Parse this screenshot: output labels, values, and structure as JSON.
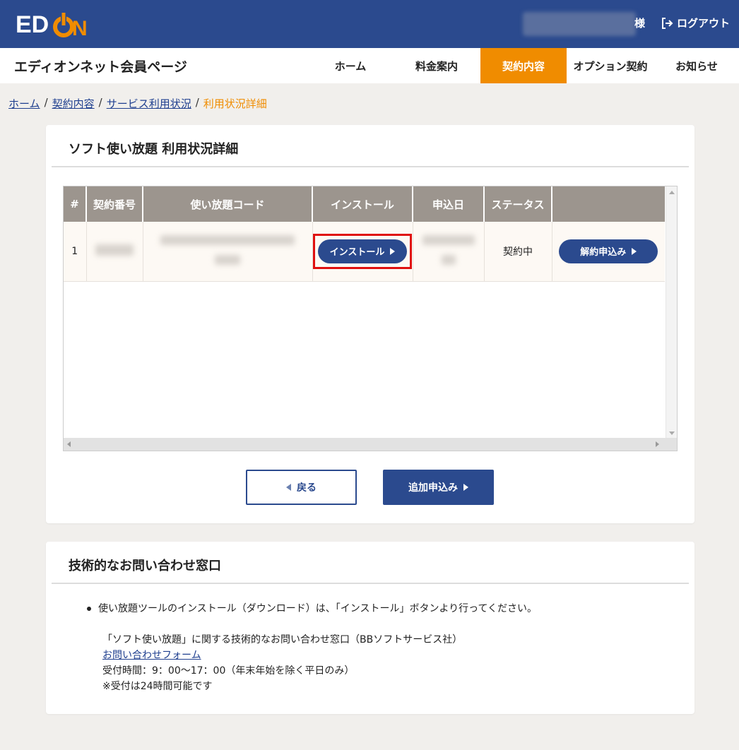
{
  "header": {
    "logo_text": "EDION",
    "user_suffix": "様",
    "logout_label": "ログアウト"
  },
  "nav": {
    "site_title": "エディオンネット会員ページ",
    "items": [
      "ホーム",
      "料金案内",
      "契約内容",
      "オプション契約",
      "お知らせ"
    ],
    "active": "契約内容"
  },
  "breadcrumb": {
    "items": [
      "ホーム",
      "契約内容",
      "サービス利用状況"
    ],
    "current": "利用状況詳細"
  },
  "detail": {
    "title": "ソフト使い放題 利用状況詳細",
    "columns": [
      "#",
      "契約番号",
      "使い放題コード",
      "インストール",
      "申込日",
      "ステータス",
      ""
    ],
    "row": {
      "index": "1",
      "install_label": "インストール",
      "status": "契約中",
      "cancel_label": "解約申込み"
    },
    "back_label": "戻る",
    "add_label": "追加申込み"
  },
  "support": {
    "title": "技術的なお問い合わせ窓口",
    "bullet": "使い放題ツールのインストール（ダウンロード）は、「インストール」ボタンより行ってください。",
    "line1": "「ソフト使い放題」に関する技術的なお問い合わせ窓口（BBソフトサービス社）",
    "link": "お問い合わせフォーム",
    "hours": "受付時間：9：00〜17：00（年末年始を除く平日のみ）",
    "note": "※受付は24時間可能です"
  },
  "colors": {
    "brand_blue": "#2b4a8e",
    "accent_orange": "#f08c00",
    "highlight_red": "#e01010"
  }
}
